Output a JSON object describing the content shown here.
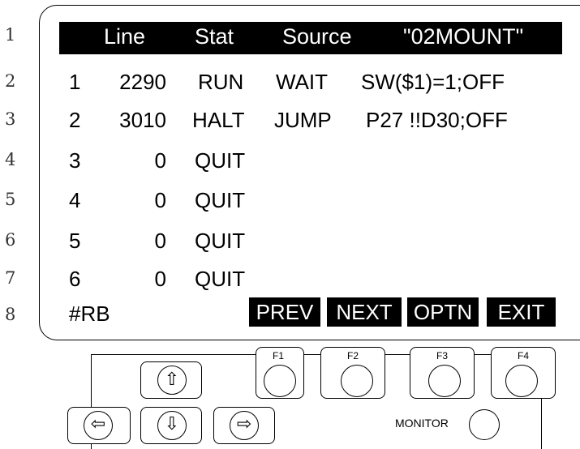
{
  "line_numbers": [
    "1",
    "2",
    "3",
    "4",
    "5",
    "6",
    "7",
    "8"
  ],
  "header": {
    "line": "Line",
    "stat": "Stat",
    "source": "Source",
    "program": "\"02MOUNT\""
  },
  "rows": [
    {
      "task": "1",
      "line": "2290",
      "stat": "RUN",
      "source": "WAIT",
      "detail": "SW($1)=1;OFF"
    },
    {
      "task": "2",
      "line": "3010",
      "stat": "HALT",
      "source": "JUMP",
      "detail": "P27 !!D30;OFF"
    },
    {
      "task": "3",
      "line": "0",
      "stat": "QUIT",
      "source": "",
      "detail": ""
    },
    {
      "task": "4",
      "line": "0",
      "stat": "QUIT",
      "source": "",
      "detail": ""
    },
    {
      "task": "5",
      "line": "0",
      "stat": "QUIT",
      "source": "",
      "detail": ""
    },
    {
      "task": "6",
      "line": "0",
      "stat": "QUIT",
      "source": "",
      "detail": ""
    }
  ],
  "footer": {
    "prompt": "#RB",
    "function_labels": [
      "PREV",
      "NEXT",
      "OPTN",
      "EXIT"
    ]
  },
  "keypad": {
    "function_keys": [
      "F1",
      "F2",
      "F3",
      "F4"
    ],
    "monitor": "MONITOR",
    "arrows": {
      "up": "⇧",
      "down": "⇩",
      "left": "⇦",
      "right": "⇨"
    }
  }
}
